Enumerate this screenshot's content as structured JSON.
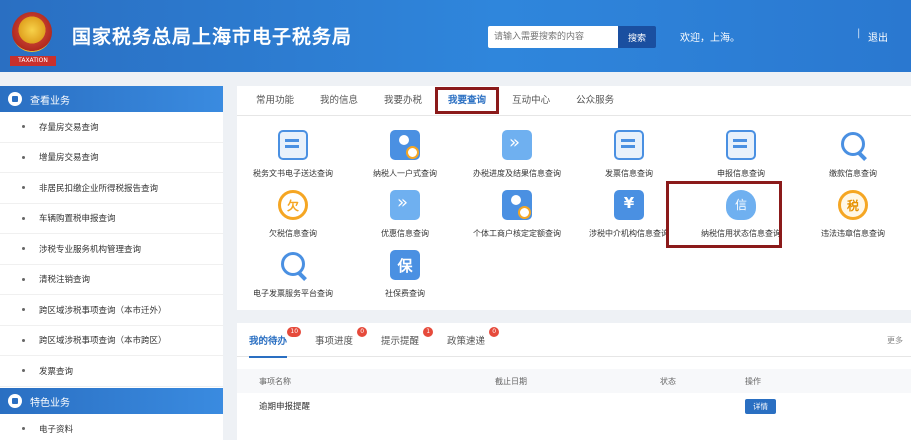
{
  "header": {
    "title": "国家税务总局上海市电子税务局",
    "emblem_label": "TAXATION",
    "search_placeholder": "请输入需要搜索的内容",
    "search_button": "搜索",
    "welcome": "欢迎，上海。",
    "separator": "|",
    "logout": "退出"
  },
  "sidebar": {
    "section1": "查看业务",
    "items": [
      "存量房交易查询",
      "增量房交易查询",
      "非居民扣缴企业所得税报告查询",
      "车辆购置税申报查询",
      "涉税专业服务机构管理查询",
      "清税注销查询",
      "跨区域涉税事项查询（本市迁外）",
      "跨区域涉税事项查询（本市跨区）",
      "发票查询"
    ],
    "section2": "特色业务",
    "items2": [
      "电子资料"
    ]
  },
  "main": {
    "tabs": [
      {
        "label": "常用功能"
      },
      {
        "label": "我的信息"
      },
      {
        "label": "我要办税"
      },
      {
        "label": "我要查询"
      },
      {
        "label": "互动中心"
      },
      {
        "label": "公众服务"
      }
    ],
    "active_tab": "我要查询",
    "services": [
      {
        "label": "税务文书电子送达查询",
        "icon": "document-icon"
      },
      {
        "label": "纳税人一户式查询",
        "icon": "person-search-icon"
      },
      {
        "label": "办税进度及结果信息查询",
        "icon": "progress-icon"
      },
      {
        "label": "发票信息查询",
        "icon": "invoice-icon"
      },
      {
        "label": "申报信息查询",
        "icon": "declaration-icon"
      },
      {
        "label": "缴款信息查询",
        "icon": "magnifier-icon"
      },
      {
        "label": "欠税信息查询",
        "icon": "arrears-icon"
      },
      {
        "label": "优惠信息查询",
        "icon": "discount-icon"
      },
      {
        "label": "个体工商户核定定额查询",
        "icon": "business-icon"
      },
      {
        "label": "涉税中介机构信息查询",
        "icon": "agency-icon"
      },
      {
        "label": "纳税信用状态信息查询",
        "icon": "credit-icon"
      },
      {
        "label": "违法违章信息查询",
        "icon": "violation-icon"
      },
      {
        "label": "电子发票服务平台查询",
        "icon": "magnifier-icon"
      },
      {
        "label": "社保费查询",
        "icon": "social-security-icon"
      }
    ]
  },
  "tasks": {
    "tabs": [
      {
        "label": "我的待办",
        "count": "10"
      },
      {
        "label": "事项进度",
        "count": "0"
      },
      {
        "label": "提示提醒",
        "count": "1"
      },
      {
        "label": "政策速递",
        "count": "0"
      }
    ],
    "more": "更多",
    "columns": [
      "事项名称",
      "截止日期",
      "状态",
      "操作"
    ],
    "rows": [
      {
        "name": "逾期申报提醒",
        "date": "",
        "status": "",
        "action": "详情"
      }
    ]
  },
  "colors": {
    "header_blue": "#2a78d0",
    "accent": "#2a6fc2",
    "highlight_border": "#8b1a1a",
    "badge_red": "#e64a3b"
  }
}
